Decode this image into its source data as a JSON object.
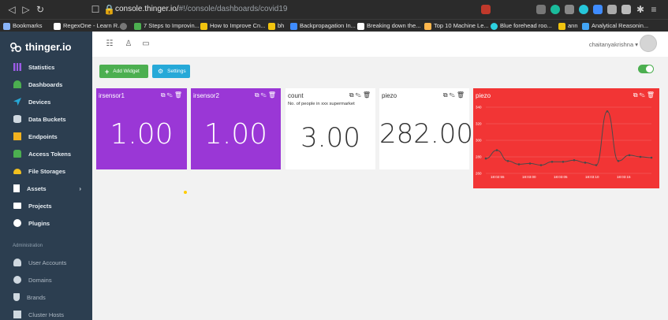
{
  "browser": {
    "url_host": "console.thinger.io/",
    "url_path": "#!/console/dashboards/covid19",
    "bookmarks": [
      {
        "label": "Bookmarks",
        "color": "#8ab4f8"
      },
      {
        "label": "RegexOne - Learn R...",
        "color": "#ffffff"
      },
      {
        "label": "",
        "color": "#777777"
      },
      {
        "label": "7 Steps to Improvin...",
        "color": "#4caf50"
      },
      {
        "label": "How to Improve Cn...",
        "color": "#f1c40f"
      },
      {
        "label": "bh",
        "color": "#f1c40f"
      },
      {
        "label": "Backpropagation In...",
        "color": "#3f8cff"
      },
      {
        "label": "Breaking down the...",
        "color": "#ffffff"
      },
      {
        "label": "Top 10 Machine Le...",
        "color": "#ffb74d"
      },
      {
        "label": "Blue forehead roo...",
        "color": "#2dd2e0"
      },
      {
        "label": "ann",
        "color": "#f1c40f"
      },
      {
        "label": "Analytical Reasonin...",
        "color": "#42a5f5"
      }
    ]
  },
  "sidebar": {
    "logo": "thinger.io",
    "items": [
      {
        "label": "Statistics",
        "icon": "bar-chart-icon",
        "color": "#9c5ce6"
      },
      {
        "label": "Dashboards",
        "icon": "dashboard-icon",
        "color": "#4caf50"
      },
      {
        "label": "Devices",
        "icon": "rocket-icon",
        "color": "#26a9d8"
      },
      {
        "label": "Data Buckets",
        "icon": "database-icon",
        "color": "#cfd8e0"
      },
      {
        "label": "Endpoints",
        "icon": "endpoint-icon",
        "color": "#f2b21f"
      },
      {
        "label": "Access Tokens",
        "icon": "lock-icon",
        "color": "#4caf50"
      },
      {
        "label": "File Storages",
        "icon": "cloud-icon",
        "color": "#f2c01f"
      },
      {
        "label": "Assets",
        "icon": "building-icon",
        "color": "#ffffff"
      },
      {
        "label": "Projects",
        "icon": "folder-icon",
        "color": "#ffffff"
      },
      {
        "label": "Plugins",
        "icon": "puzzle-icon",
        "color": "#ffffff"
      }
    ],
    "admin_section": "Administration",
    "admin_items": [
      {
        "label": "User Accounts",
        "icon": "users-icon"
      },
      {
        "label": "Domains",
        "icon": "globe-icon"
      },
      {
        "label": "Brands",
        "icon": "shield-icon"
      },
      {
        "label": "Cluster Hosts",
        "icon": "hosts-icon"
      }
    ]
  },
  "topbar": {
    "username": "chaitanyakrishna"
  },
  "toolbar": {
    "add_widget": "Add Widget",
    "settings": "Settings"
  },
  "widgets": [
    {
      "title": "irsensor1",
      "subtitle": "",
      "value": "1.00"
    },
    {
      "title": "irsensor2",
      "subtitle": "",
      "value": "1.00"
    },
    {
      "title": "count",
      "subtitle": "No. of people in xxx supermarket",
      "value": "3.00"
    },
    {
      "title": "piezo",
      "subtitle": "",
      "value": "282.00"
    }
  ],
  "chart_widget": {
    "title": "piezo"
  },
  "chart_data": {
    "type": "line",
    "title": "piezo",
    "x": [
      "18:02:54",
      "18:02:57",
      "18:03:00",
      "18:03:03",
      "18:03:06",
      "18:03:09",
      "18:03:12",
      "18:03:15",
      "18:03:18",
      "18:03:21",
      "18:03:24",
      "18:03:27",
      "18:03:30",
      "18:03:33",
      "18:03:36",
      "18:03:39"
    ],
    "values": [
      278,
      288,
      275,
      271,
      272,
      270,
      274,
      274,
      276,
      273,
      270,
      335,
      275,
      282,
      280,
      279
    ],
    "ylim": [
      260,
      340
    ],
    "yticks": [
      260,
      280,
      300,
      320,
      340
    ],
    "xtick_labels": [
      "18:02:55",
      "18:03:00",
      "18:03:05",
      "18:03:10",
      "18:03:15"
    ],
    "line_color": "#4a4a4a"
  }
}
